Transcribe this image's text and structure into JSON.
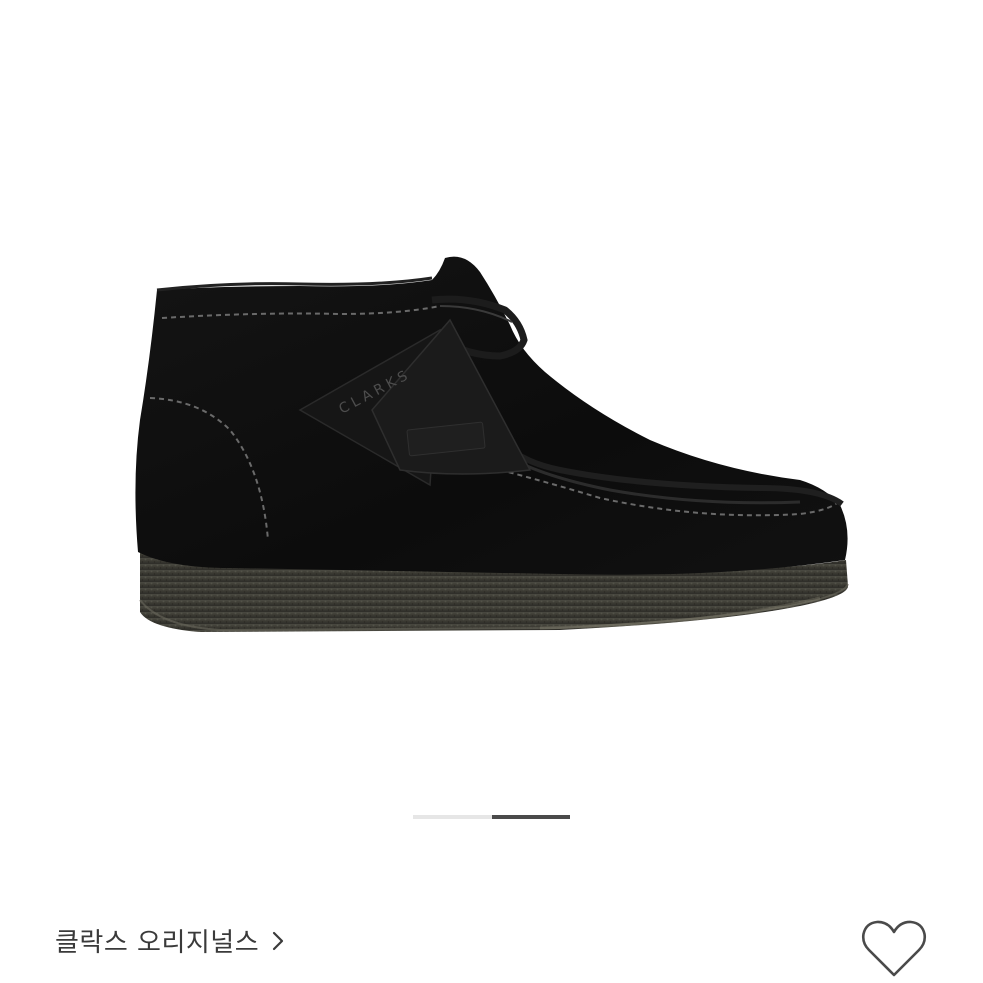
{
  "product": {
    "image_alt": "Black suede moccasin-style ankle boot with crepe sole",
    "image_tag_text": "CLARKS"
  },
  "carousel": {
    "total_slides": 2,
    "active_index": 1,
    "active_color": "#4a4a4a",
    "inactive_color": "#e6e6e6"
  },
  "brand": {
    "name": "클락스 오리지널스"
  },
  "icons": {
    "brand_link": "chevron-right-icon",
    "like": "heart-outline-icon"
  },
  "colors": {
    "text": "#3a3a3a",
    "icon_stroke": "#4a4a4a"
  }
}
